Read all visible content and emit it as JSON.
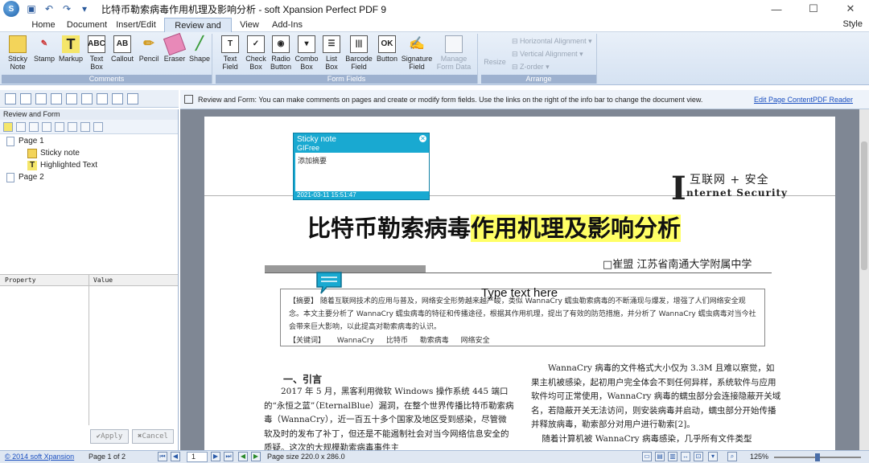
{
  "window": {
    "title": "比特币勒索病毒作用机理及影响分析 - soft Xpansion Perfect PDF 9",
    "controls": {
      "minimize": "—",
      "maximize": "☐",
      "close": "✕"
    }
  },
  "tabs": [
    {
      "label": "Home"
    },
    {
      "label": "Document"
    },
    {
      "label": "Insert/Edit"
    },
    {
      "label": "Review and Form"
    },
    {
      "label": "View"
    },
    {
      "label": "Add-Ins"
    }
  ],
  "style_menu": "Style",
  "ribbon": {
    "comments": {
      "label": "Comments",
      "buttons": [
        "Sticky Note",
        "Stamp",
        "Markup",
        "Text Box",
        "Callout",
        "Pencil",
        "Eraser",
        "Shape"
      ]
    },
    "form_fields": {
      "label": "Form Fields",
      "buttons": [
        "Text Field",
        "Check Box",
        "Radio Button",
        "Combo Box",
        "List Box",
        "Barcode Field",
        "Button",
        "Signature Field",
        "Manage Form Data"
      ]
    },
    "arrange": {
      "label": "Arrange",
      "resize": "Resize",
      "horizontal": "Horizontal Alignment",
      "vertical": "Vertical Alignment",
      "zorder": "Z-order"
    }
  },
  "infobar": {
    "message": "Review and Form: You can make comments on pages and create or modify form fields. Use the links on the right of the info bar to change the document view.",
    "link_edit": "Edit Page Content",
    "link_reader": "PDF Reader"
  },
  "left_panel": {
    "title": "Review and Form",
    "tree": [
      {
        "label": "Page 1"
      },
      {
        "label": "Sticky note"
      },
      {
        "label": "Highlighted Text"
      },
      {
        "label": "Page 2"
      }
    ],
    "property_header": "Property",
    "value_header": "Value",
    "apply": "Apply",
    "cancel": "Cancel"
  },
  "document": {
    "logo_i": "I",
    "logo_cn": "互联网 + 安全",
    "logo_en": "nternet  Security",
    "title_plain": "比特币勒索病毒",
    "title_highlight": "作用机理及影响分析",
    "author": "□崔盟    江苏省南通大学附属中学",
    "abstract": "【摘要】    随着互联网技术的应用与普及，网络安全形势越来越严峻，类似 WannaCry 蠕虫勒索病毒的不断涌现与爆发，增强了人们网络安全观念。本文主要分析了 WannaCry 蠕虫病毒的特征和传播途径，根据其作用机理，提出了有效的防范措施，并分析了 WannaCry 蠕虫病毒对当今社会带来巨大影响，以此提高对勒索病毒的认识。",
    "keywords_label": "【关键词】",
    "keywords": [
      "WannaCry",
      "比特币",
      "勒索病毒",
      "网络安全"
    ],
    "type_text": "Type text here",
    "section1": "一、引言",
    "col_left": "2017 年 5 月，黑客利用微软 Windows 操作系统 445 端口的“永恒之蓝”（EternalBlue）漏洞，在整个世界传播比特币勒索病毒（WannaCry），近一百五十多个国家及地区受到感染，尽管微软及时的发布了补丁，但还是不能遏制社会对当今网络信息安全的质疑。这次的大规模勒索病毒事件主",
    "col_right": "WannaCry 病毒的文件格式大小仅为 3.3M 且难以察觉，如果主机被感染，起初用户完全体会不到任何异样，系统软件与应用软件均可正常使用，WannaCry 病毒的蠕虫部分会连接隐蔽开关域名，若隐蔽开关无法访问，则安装病毒并启动，蠕虫部分开始传播并释放病毒，勒索部分对用户进行勒索[2]。\n    随着计算机被 WannaCry 病毒感染，几乎所有文件类型"
  },
  "sticky_note": {
    "title": "Sticky note",
    "author": "GIFree",
    "content": "添加摘要",
    "timestamp": "2021-03-11 15:51:47"
  },
  "status": {
    "copyright": "© 2014 soft Xpansion",
    "page_info": "Page 1 of 2",
    "page_input": "1",
    "page_size": "Page size 220.0 x 286.0",
    "zoom": "125%",
    "zoom_fraction": 0.5
  },
  "colors": {
    "accent": "#19a9d1",
    "highlight": "#ffff66",
    "link": "#1a4fc0"
  }
}
